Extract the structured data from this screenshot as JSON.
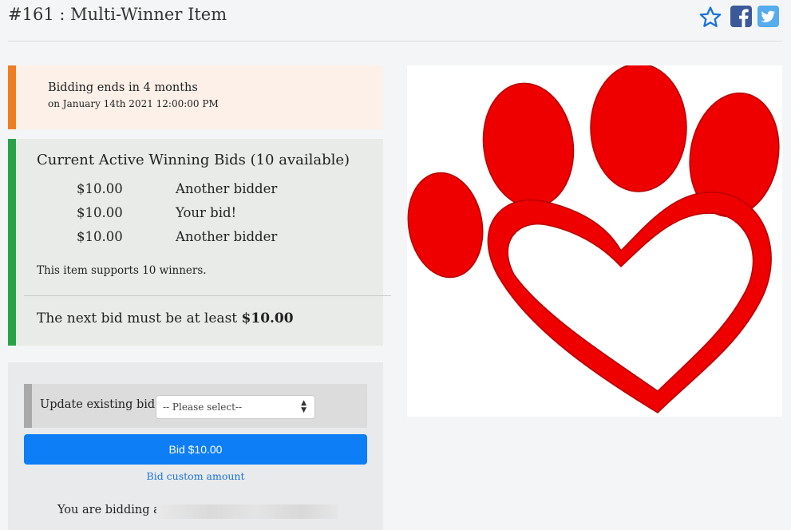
{
  "header": {
    "title": "#161 : Multi-Winner Item",
    "icons": [
      "star-icon",
      "facebook-icon",
      "twitter-icon"
    ],
    "colors": {
      "star": "#1a73d8",
      "facebook": "#3b5998",
      "twitter": "#55acee"
    }
  },
  "ends": {
    "main": "Bidding ends in 4 months",
    "sub": "on January 14th 2021 12:00:00 PM",
    "accent": "#f07d24"
  },
  "bids": {
    "title": "Current Active Winning Bids (10 available)",
    "rows": [
      {
        "amount": "$10.00",
        "name": "Another bidder"
      },
      {
        "amount": "$10.00",
        "name": "Your bid!"
      },
      {
        "amount": "$10.00",
        "name": "Another bidder"
      }
    ],
    "winners_note": "This item supports 10 winners.",
    "next_bid_prefix": "The next bid must be at least",
    "next_bid_amount": "$10.00",
    "accent": "#2aa24a"
  },
  "form": {
    "update_label": "Update existing bid?",
    "select_value": "-- Please select--",
    "bid_button": "Bid $10.00",
    "custom_link": "Bid custom amount",
    "bidding_as": "You are bidding as",
    "button_color": "#0d7ef5"
  },
  "image": {
    "icon": "paw-heart-icon",
    "color": "#ee0000"
  }
}
